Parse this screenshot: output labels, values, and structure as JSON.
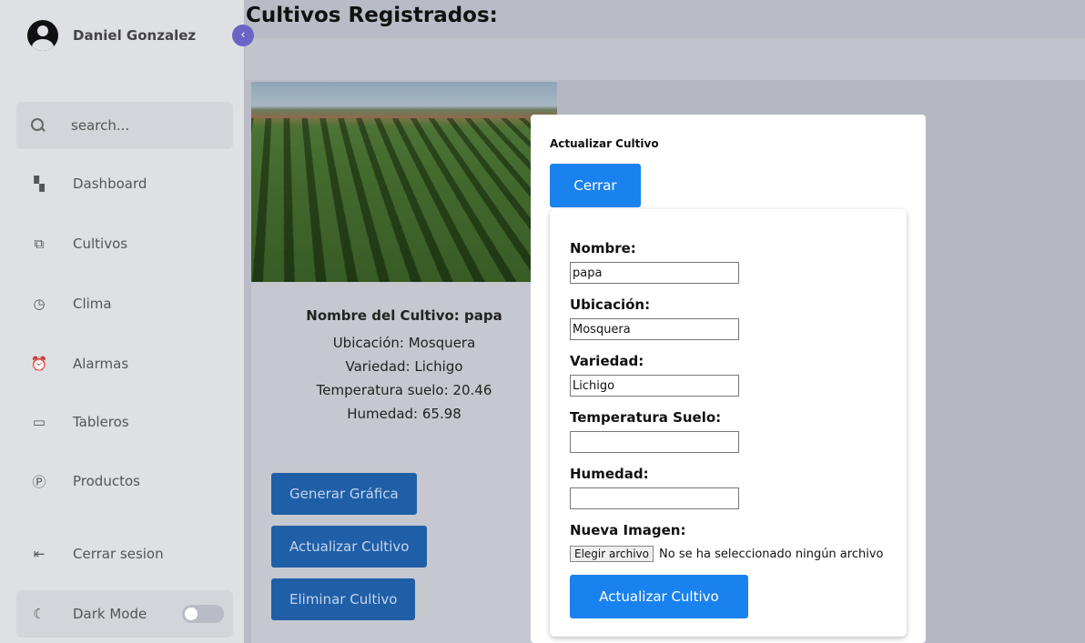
{
  "user": {
    "name": "Daniel Gonzalez"
  },
  "sidebar": {
    "toggle_icon": "‹",
    "search_placeholder": "search...",
    "items": [
      {
        "label": "Dashboard",
        "icon": "dashboard-icon"
      },
      {
        "label": "Cultivos",
        "icon": "cultivos-icon"
      },
      {
        "label": "Clima",
        "icon": "clock-icon"
      },
      {
        "label": "Alarmas",
        "icon": "alarm-icon"
      },
      {
        "label": "Tableros",
        "icon": "board-icon"
      },
      {
        "label": "Productos",
        "icon": "product-icon"
      },
      {
        "label": "Cerrar sesion",
        "icon": "logout-icon"
      }
    ],
    "dark_mode": {
      "label": "Dark Mode",
      "enabled": false
    }
  },
  "page": {
    "title": "Cultivos Registrados:"
  },
  "card": {
    "title": "Nombre del Cultivo: papa",
    "ubicacion": "Ubicación: Mosquera",
    "variedad": "Variedad: Lichigo",
    "temperatura": "Temperatura suelo: 20.46",
    "humedad": "Humedad: 65.98",
    "buttons": {
      "grafica": "Generar Gráfica",
      "actualizar": "Actualizar Cultivo",
      "eliminar": "Eliminar Cultivo"
    }
  },
  "modal": {
    "title": "Actualizar Cultivo",
    "close_label": "Cerrar",
    "fields": {
      "nombre": {
        "label": "Nombre:",
        "value": "papa"
      },
      "ubicacion": {
        "label": "Ubicación:",
        "value": "Mosquera"
      },
      "variedad": {
        "label": "Variedad:",
        "value": "Lichigo"
      },
      "temperatura": {
        "label": "Temperatura Suelo:",
        "value": ""
      },
      "humedad": {
        "label": "Humedad:",
        "value": ""
      },
      "imagen": {
        "label": "Nueva Imagen:",
        "button": "Elegir archivo",
        "status": "No se ha seleccionado ningún archivo"
      }
    },
    "submit_label": "Actualizar Cultivo"
  },
  "colors": {
    "primary": "#1a82ef",
    "overlay_button": "#1f5fa8",
    "accent": "#6c63c6"
  }
}
